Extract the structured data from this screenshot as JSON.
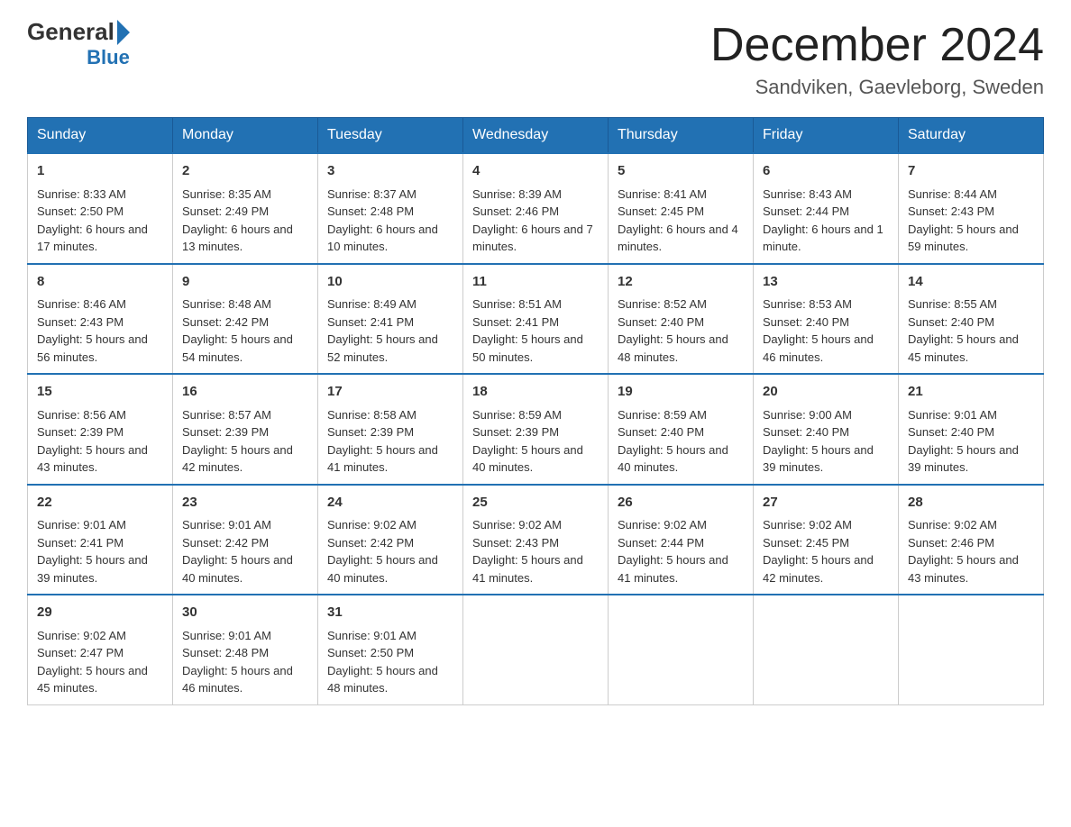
{
  "header": {
    "logo_general": "General",
    "logo_blue": "Blue",
    "title": "December 2024",
    "subtitle": "Sandviken, Gaevleborg, Sweden"
  },
  "days_of_week": [
    "Sunday",
    "Monday",
    "Tuesday",
    "Wednesday",
    "Thursday",
    "Friday",
    "Saturday"
  ],
  "weeks": [
    [
      {
        "day": "1",
        "sunrise": "8:33 AM",
        "sunset": "2:50 PM",
        "daylight": "6 hours and 17 minutes."
      },
      {
        "day": "2",
        "sunrise": "8:35 AM",
        "sunset": "2:49 PM",
        "daylight": "6 hours and 13 minutes."
      },
      {
        "day": "3",
        "sunrise": "8:37 AM",
        "sunset": "2:48 PM",
        "daylight": "6 hours and 10 minutes."
      },
      {
        "day": "4",
        "sunrise": "8:39 AM",
        "sunset": "2:46 PM",
        "daylight": "6 hours and 7 minutes."
      },
      {
        "day": "5",
        "sunrise": "8:41 AM",
        "sunset": "2:45 PM",
        "daylight": "6 hours and 4 minutes."
      },
      {
        "day": "6",
        "sunrise": "8:43 AM",
        "sunset": "2:44 PM",
        "daylight": "6 hours and 1 minute."
      },
      {
        "day": "7",
        "sunrise": "8:44 AM",
        "sunset": "2:43 PM",
        "daylight": "5 hours and 59 minutes."
      }
    ],
    [
      {
        "day": "8",
        "sunrise": "8:46 AM",
        "sunset": "2:43 PM",
        "daylight": "5 hours and 56 minutes."
      },
      {
        "day": "9",
        "sunrise": "8:48 AM",
        "sunset": "2:42 PM",
        "daylight": "5 hours and 54 minutes."
      },
      {
        "day": "10",
        "sunrise": "8:49 AM",
        "sunset": "2:41 PM",
        "daylight": "5 hours and 52 minutes."
      },
      {
        "day": "11",
        "sunrise": "8:51 AM",
        "sunset": "2:41 PM",
        "daylight": "5 hours and 50 minutes."
      },
      {
        "day": "12",
        "sunrise": "8:52 AM",
        "sunset": "2:40 PM",
        "daylight": "5 hours and 48 minutes."
      },
      {
        "day": "13",
        "sunrise": "8:53 AM",
        "sunset": "2:40 PM",
        "daylight": "5 hours and 46 minutes."
      },
      {
        "day": "14",
        "sunrise": "8:55 AM",
        "sunset": "2:40 PM",
        "daylight": "5 hours and 45 minutes."
      }
    ],
    [
      {
        "day": "15",
        "sunrise": "8:56 AM",
        "sunset": "2:39 PM",
        "daylight": "5 hours and 43 minutes."
      },
      {
        "day": "16",
        "sunrise": "8:57 AM",
        "sunset": "2:39 PM",
        "daylight": "5 hours and 42 minutes."
      },
      {
        "day": "17",
        "sunrise": "8:58 AM",
        "sunset": "2:39 PM",
        "daylight": "5 hours and 41 minutes."
      },
      {
        "day": "18",
        "sunrise": "8:59 AM",
        "sunset": "2:39 PM",
        "daylight": "5 hours and 40 minutes."
      },
      {
        "day": "19",
        "sunrise": "8:59 AM",
        "sunset": "2:40 PM",
        "daylight": "5 hours and 40 minutes."
      },
      {
        "day": "20",
        "sunrise": "9:00 AM",
        "sunset": "2:40 PM",
        "daylight": "5 hours and 39 minutes."
      },
      {
        "day": "21",
        "sunrise": "9:01 AM",
        "sunset": "2:40 PM",
        "daylight": "5 hours and 39 minutes."
      }
    ],
    [
      {
        "day": "22",
        "sunrise": "9:01 AM",
        "sunset": "2:41 PM",
        "daylight": "5 hours and 39 minutes."
      },
      {
        "day": "23",
        "sunrise": "9:01 AM",
        "sunset": "2:42 PM",
        "daylight": "5 hours and 40 minutes."
      },
      {
        "day": "24",
        "sunrise": "9:02 AM",
        "sunset": "2:42 PM",
        "daylight": "5 hours and 40 minutes."
      },
      {
        "day": "25",
        "sunrise": "9:02 AM",
        "sunset": "2:43 PM",
        "daylight": "5 hours and 41 minutes."
      },
      {
        "day": "26",
        "sunrise": "9:02 AM",
        "sunset": "2:44 PM",
        "daylight": "5 hours and 41 minutes."
      },
      {
        "day": "27",
        "sunrise": "9:02 AM",
        "sunset": "2:45 PM",
        "daylight": "5 hours and 42 minutes."
      },
      {
        "day": "28",
        "sunrise": "9:02 AM",
        "sunset": "2:46 PM",
        "daylight": "5 hours and 43 minutes."
      }
    ],
    [
      {
        "day": "29",
        "sunrise": "9:02 AM",
        "sunset": "2:47 PM",
        "daylight": "5 hours and 45 minutes."
      },
      {
        "day": "30",
        "sunrise": "9:01 AM",
        "sunset": "2:48 PM",
        "daylight": "5 hours and 46 minutes."
      },
      {
        "day": "31",
        "sunrise": "9:01 AM",
        "sunset": "2:50 PM",
        "daylight": "5 hours and 48 minutes."
      },
      null,
      null,
      null,
      null
    ]
  ]
}
